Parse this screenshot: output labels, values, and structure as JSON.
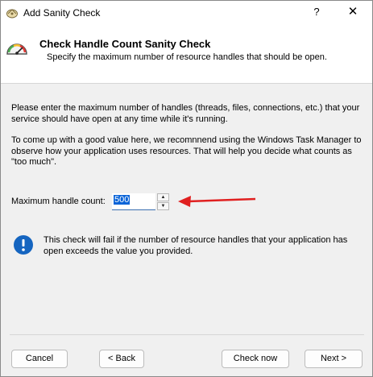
{
  "window": {
    "title": "Add Sanity Check",
    "help_label": "?",
    "close_label": "✕"
  },
  "header": {
    "title": "Check Handle Count Sanity Check",
    "subtitle": "Specify the maximum number of resource handles that should be open.",
    "icon": "gauge-icon"
  },
  "body": {
    "paragraph1": "Please enter the maximum number of handles (threads, files, connections, etc.) that your service should have open at any time while it's running.",
    "paragraph2": "To come up with a good value here, we recomnnend using the Windows Task Manager to observe how your application uses resources. That will help you decide what counts as \"too much\".",
    "max_label": "Maximum handle count:",
    "max_value": "500",
    "info_text": "This check will fail if the number of resource handles that your application has open exceeds the value you provided.",
    "info_icon": "info-icon"
  },
  "buttons": {
    "cancel": "Cancel",
    "back": "< Back",
    "check_now": "Check now",
    "next": "Next >"
  },
  "colors": {
    "annotation_arrow": "#e02020",
    "selection": "#0a64d8",
    "info_icon": "#1565c0"
  }
}
